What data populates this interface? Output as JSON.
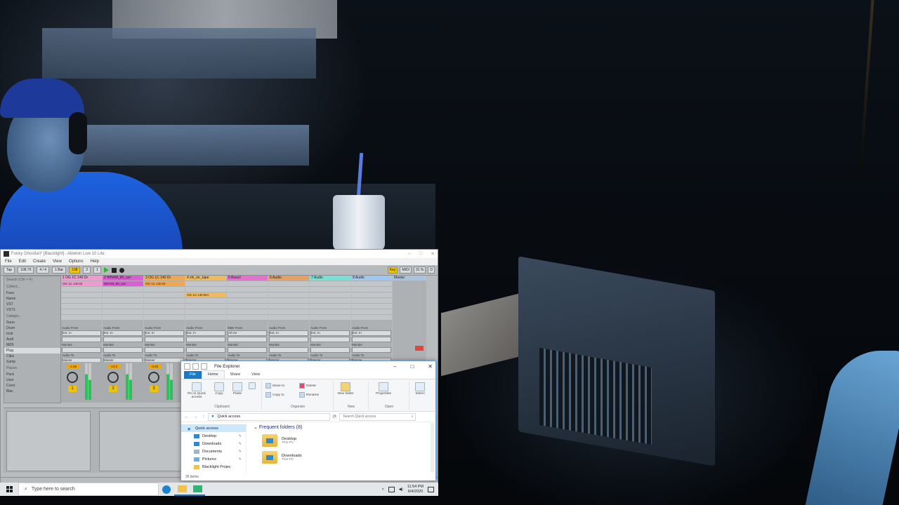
{
  "ableton": {
    "title": "Funky Ghostlari* [Blacklight] - Ableton Live 10 Lite",
    "menu": [
      "File",
      "Edit",
      "Create",
      "View",
      "Options",
      "Help"
    ],
    "transport": {
      "tap": "Tap",
      "bpm": "108.79",
      "meter": "4 / 4",
      "bar": "1 Bar",
      "pos1": "108",
      "pos2": "2",
      "pos3": "1",
      "key": "Key",
      "midi": "MIDI",
      "cpu": "31 %",
      "d": "D"
    },
    "browser": {
      "collections_label": "Collect...",
      "places_label": "Places",
      "search": "Search (Ctrl + F)",
      "name_header": "Name",
      "items": [
        "Favo",
        "VST",
        "VST3"
      ],
      "categories_label": "Categor...",
      "categories": [
        "Soun",
        "Drum",
        "Instr",
        "Audi",
        "MIDI",
        "Plug",
        "Clips",
        "Samp"
      ],
      "places": [
        "Pack",
        "User",
        "Curre",
        "Blac"
      ]
    },
    "tracks": [
      {
        "name": "1 OG 1C 140 Dr",
        "color": "#f09ad0",
        "clip": "OG 1C 140 Dr",
        "level": "-1.56",
        "num": "1"
      },
      {
        "name": "2 WHAM_80_syn",
        "color": "#e15bd8",
        "clip": "WHAM_80_syn",
        "level": "-13.0",
        "num": "2"
      },
      {
        "name": "3 OG 1C 140 Dr",
        "color": "#f4a74a",
        "clip": "OG 1C 140 Dr",
        "level": "-3.03",
        "num": "3"
      },
      {
        "name": "4 sfx_inr_tape",
        "color": "#f1b957",
        "clip": "OG 1C 140 Bro",
        "level": "",
        "num": ""
      },
      {
        "name": "5 Bass2",
        "color": "#ea6fd0",
        "clip": "",
        "level": "",
        "num": ""
      },
      {
        "name": "6 Audio",
        "color": "#e8a05e",
        "clip": "",
        "level": "",
        "num": ""
      },
      {
        "name": "7 Audio",
        "color": "#76e2d6",
        "clip": "",
        "level": "",
        "num": ""
      },
      {
        "name": "8 Audio",
        "color": "#9ec8ef",
        "clip": "",
        "level": "",
        "num": ""
      }
    ],
    "io": {
      "audio_from": "Audio From",
      "midi_from": "MIDI From",
      "ext_in": "Ext. In",
      "all_ins": "All Ins",
      "all_channels": "All Channels",
      "monitor": "Monitor",
      "audio_to": "Audio To",
      "master": "Master"
    },
    "master": {
      "name": "Master",
      "cue_out": "Cue Out",
      "cue_val": "1/2",
      "master_out": "Master Out"
    }
  },
  "explorer": {
    "title": "File Explorer",
    "tabs": [
      "File",
      "Home",
      "Share",
      "View"
    ],
    "ribbon": {
      "pin": "Pin to Quick access",
      "copy": "Copy",
      "paste": "Paste",
      "move_to": "Move to",
      "copy_to": "Copy to",
      "delete": "Delete",
      "rename": "Rename",
      "new_folder": "New folder",
      "properties": "Properties",
      "select": "Select",
      "groups": [
        "Clipboard",
        "Organize",
        "New",
        "Open"
      ]
    },
    "address": "Quick access",
    "search_placeholder": "Search Quick access",
    "nav": [
      "Quick access",
      "Desktop",
      "Downloads",
      "Documents",
      "Pictures",
      "Blacklight Projec"
    ],
    "section": "Frequent folders (8)",
    "folders": [
      {
        "name": "Desktop",
        "sub": "This PC"
      },
      {
        "name": "Downloads",
        "sub": "This PC"
      }
    ],
    "status": "26 items"
  },
  "taskbar": {
    "search_placeholder": "Type here to search",
    "time": "11:54 PM",
    "date": "6/4/2020"
  }
}
